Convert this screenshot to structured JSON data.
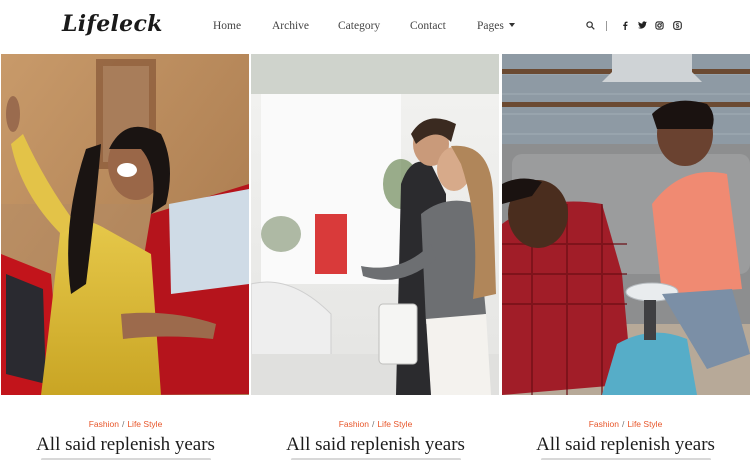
{
  "brand": {
    "logo": "Lifeleck"
  },
  "nav": [
    {
      "label": "Home"
    },
    {
      "label": "Archive"
    },
    {
      "label": "Category"
    },
    {
      "label": "Contact"
    },
    {
      "label": "Pages"
    }
  ],
  "header_icons": [
    "search-icon",
    "facebook-icon",
    "twitter-icon",
    "instagram-icon",
    "skype-icon"
  ],
  "colors": {
    "accent": "#e8562a",
    "text": "#1d1d1d"
  },
  "posts": [
    {
      "category": "Fashion",
      "tag": "Life Style",
      "separator": "/",
      "title": "All said replenish years",
      "image": "woman-cheering-by-red-car"
    },
    {
      "category": "Fashion",
      "tag": "Life Style",
      "separator": "/",
      "title": "All said replenish years",
      "image": "couple-at-car-showroom"
    },
    {
      "category": "Fashion",
      "tag": "Life Style",
      "separator": "/",
      "title": "All said replenish years",
      "image": "father-and-son-with-toy-car"
    }
  ]
}
